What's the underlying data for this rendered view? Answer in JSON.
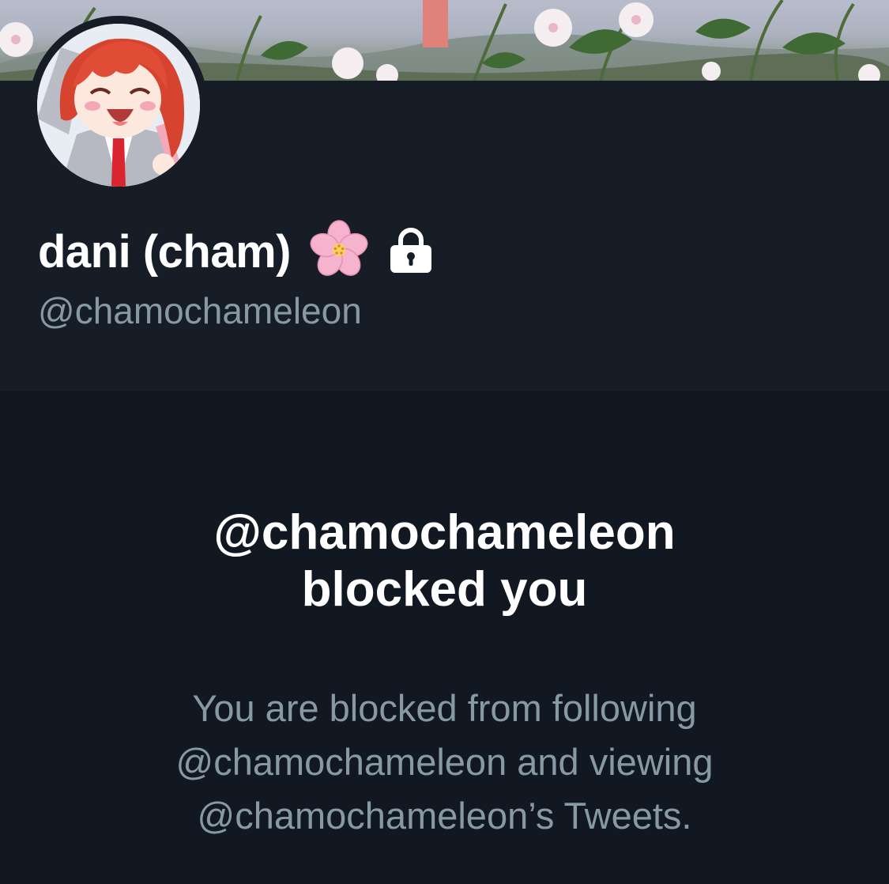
{
  "profile": {
    "display_name": "dani (cham)",
    "display_name_emoji": "cherry-blossom-icon",
    "protected_icon": "lock-icon",
    "handle": "@chamochameleon"
  },
  "blocked_notice": {
    "title_line1": "@chamochameleon",
    "title_line2": "blocked you",
    "desc_line1": "You are blocked from following",
    "desc_line2": "@chamochameleon and viewing",
    "desc_line3": "@chamochameleon’s Tweets."
  },
  "colors": {
    "background": "#111821",
    "header_panel": "#161d26",
    "primary_text": "#ffffff",
    "secondary_text": "#8899a6",
    "blossom_pink": "#f6a9c9"
  }
}
